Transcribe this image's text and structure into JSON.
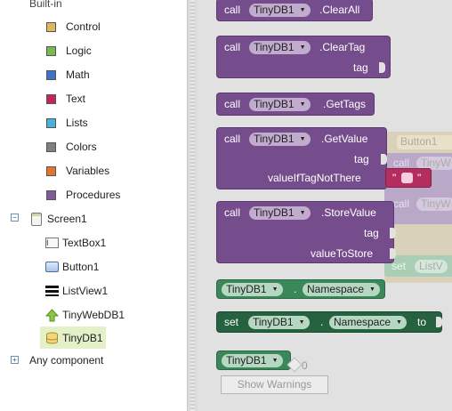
{
  "tree": {
    "builtin_label": "Built-in",
    "builtin_items": [
      {
        "label": "Control",
        "color": "#e0b75c"
      },
      {
        "label": "Logic",
        "color": "#79ba4c"
      },
      {
        "label": "Math",
        "color": "#3d74c5"
      },
      {
        "label": "Text",
        "color": "#c5255e"
      },
      {
        "label": "Lists",
        "color": "#4ab2da"
      },
      {
        "label": "Colors",
        "color": "#808080"
      },
      {
        "label": "Variables",
        "color": "#e3732d"
      },
      {
        "label": "Procedures",
        "color": "#7f5a98"
      }
    ],
    "screen_label": "Screen1",
    "components": [
      {
        "label": "TextBox1",
        "icon": "textbox-icon"
      },
      {
        "label": "Button1",
        "icon": "button-icon"
      },
      {
        "label": "ListView1",
        "icon": "listview-icon"
      },
      {
        "label": "TinyWebDB1",
        "icon": "tinywebdb-icon"
      },
      {
        "label": "TinyDB1",
        "icon": "tinydb-icon",
        "selected": true
      }
    ],
    "any_component_label": "Any component",
    "expand_symbol": "+",
    "collapse_symbol": "−"
  },
  "blocks": {
    "call_label": "call",
    "component": "TinyDB1",
    "dropdown_arrow": "▼",
    "clear_all": ".ClearAll",
    "clear_tag": ".ClearTag",
    "get_tags": ".GetTags",
    "get_value": ".GetValue",
    "store_value": ".StoreValue",
    "tag_label": "tag",
    "value_if_tag_not_there": "valueIfTagNotThere",
    "value_to_store": "valueToStore",
    "namespace": "Namespace",
    "dot": ".",
    "set_label": "set",
    "to_label": "to",
    "text_quote_open": "\"",
    "text_quote_close": "\""
  },
  "ghost": {
    "button_label": "Button1",
    "call_label": "call",
    "tinyweb_label": "TinyW",
    "set_label": "set",
    "listview_label": "ListV"
  },
  "workspace": {
    "warnings_count": "0",
    "show_warnings_label": "Show Warnings"
  },
  "colors": {
    "procedure_purple": "#764d8c",
    "getter_green": "#3a8759",
    "setter_green": "#266140",
    "text_red": "#b32d5e",
    "selected_bg": "#e4f0c8"
  }
}
